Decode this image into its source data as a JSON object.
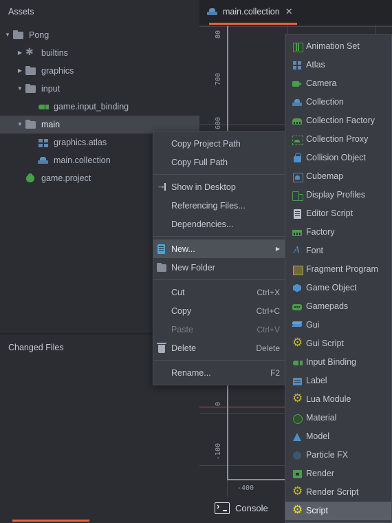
{
  "assets_panel": {
    "title": "Assets",
    "tree": [
      {
        "label": "Pong",
        "icon": "folder-icon",
        "arrow": "open",
        "indent": 0,
        "selected": false
      },
      {
        "label": "builtins",
        "icon": "builtins-icon",
        "arrow": "closed",
        "indent": 1,
        "selected": false
      },
      {
        "label": "graphics",
        "icon": "folder-icon",
        "arrow": "closed",
        "indent": 1,
        "selected": false
      },
      {
        "label": "input",
        "icon": "folder-icon",
        "arrow": "open",
        "indent": 1,
        "selected": false
      },
      {
        "label": "game.input_binding",
        "icon": "input-binding-icon",
        "arrow": "none",
        "indent": 2,
        "selected": false
      },
      {
        "label": "main",
        "icon": "folder-icon",
        "arrow": "open",
        "indent": 1,
        "selected": true
      },
      {
        "label": "graphics.atlas",
        "icon": "atlas-icon",
        "arrow": "none",
        "indent": 2,
        "selected": false
      },
      {
        "label": "main.collection",
        "icon": "collection-icon",
        "arrow": "none",
        "indent": 2,
        "selected": false
      },
      {
        "label": "game.project",
        "icon": "project-icon",
        "arrow": "none",
        "indent": 1,
        "selected": false
      }
    ]
  },
  "changed_files_panel": {
    "title": "Changed Files"
  },
  "editor": {
    "tab_label": "main.collection",
    "tab_icon": "collection-icon",
    "tab_close_glyph": "✕",
    "accent_color": "#e8623a",
    "ruler_y_ticks": [
      "80",
      "700",
      "600",
      "0",
      "-100"
    ],
    "ruler_x_ticks": [
      "-400"
    ]
  },
  "console_bar": {
    "label": "Console",
    "icon": "terminal-icon"
  },
  "context_menu": {
    "items": [
      {
        "label": "Copy Project Path",
        "icon": "",
        "shortcut": "",
        "type": "item",
        "highlight": false,
        "disabled": false,
        "submenu": false
      },
      {
        "label": "Copy Full Path",
        "icon": "",
        "shortcut": "",
        "type": "item",
        "highlight": false,
        "disabled": false,
        "submenu": false
      },
      {
        "label": "",
        "icon": "",
        "shortcut": "",
        "type": "separator",
        "highlight": false,
        "disabled": false,
        "submenu": false
      },
      {
        "label": "Show in Desktop",
        "icon": "show-desktop-icon",
        "shortcut": "",
        "type": "item",
        "highlight": false,
        "disabled": false,
        "submenu": false
      },
      {
        "label": "Referencing Files...",
        "icon": "",
        "shortcut": "",
        "type": "item",
        "highlight": false,
        "disabled": false,
        "submenu": false
      },
      {
        "label": "Dependencies...",
        "icon": "",
        "shortcut": "",
        "type": "item",
        "highlight": false,
        "disabled": false,
        "submenu": false
      },
      {
        "label": "",
        "icon": "",
        "shortcut": "",
        "type": "separator",
        "highlight": false,
        "disabled": false,
        "submenu": false
      },
      {
        "label": "New...",
        "icon": "new-document-icon",
        "shortcut": "",
        "type": "item",
        "highlight": true,
        "disabled": false,
        "submenu": true
      },
      {
        "label": "New Folder",
        "icon": "new-folder-icon",
        "shortcut": "",
        "type": "item",
        "highlight": false,
        "disabled": false,
        "submenu": false
      },
      {
        "label": "",
        "icon": "",
        "shortcut": "",
        "type": "separator",
        "highlight": false,
        "disabled": false,
        "submenu": false
      },
      {
        "label": "Cut",
        "icon": "",
        "shortcut": "Ctrl+X",
        "type": "item",
        "highlight": false,
        "disabled": false,
        "submenu": false
      },
      {
        "label": "Copy",
        "icon": "",
        "shortcut": "Ctrl+C",
        "type": "item",
        "highlight": false,
        "disabled": false,
        "submenu": false
      },
      {
        "label": "Paste",
        "icon": "",
        "shortcut": "Ctrl+V",
        "type": "item",
        "highlight": false,
        "disabled": true,
        "submenu": false
      },
      {
        "label": "Delete",
        "icon": "trash-icon",
        "shortcut": "Delete",
        "type": "item",
        "highlight": false,
        "disabled": false,
        "submenu": false
      },
      {
        "label": "",
        "icon": "",
        "shortcut": "",
        "type": "separator",
        "highlight": false,
        "disabled": false,
        "submenu": false
      },
      {
        "label": "Rename...",
        "icon": "",
        "shortcut": "F2",
        "type": "item",
        "highlight": false,
        "disabled": false,
        "submenu": false
      }
    ]
  },
  "new_submenu": {
    "items": [
      {
        "label": "Animation Set",
        "icon": "animation-set-icon",
        "highlight": false
      },
      {
        "label": "Atlas",
        "icon": "atlas-icon",
        "highlight": false
      },
      {
        "label": "Camera",
        "icon": "camera-icon",
        "highlight": false
      },
      {
        "label": "Collection",
        "icon": "collection-icon",
        "highlight": false
      },
      {
        "label": "Collection Factory",
        "icon": "collection-factory-icon",
        "highlight": false
      },
      {
        "label": "Collection Proxy",
        "icon": "collection-proxy-icon",
        "highlight": false
      },
      {
        "label": "Collision Object",
        "icon": "collision-object-icon",
        "highlight": false
      },
      {
        "label": "Cubemap",
        "icon": "cubemap-icon",
        "highlight": false
      },
      {
        "label": "Display Profiles",
        "icon": "display-profiles-icon",
        "highlight": false
      },
      {
        "label": "Editor Script",
        "icon": "editor-script-icon",
        "highlight": false
      },
      {
        "label": "Factory",
        "icon": "factory-icon",
        "highlight": false
      },
      {
        "label": "Font",
        "icon": "font-icon",
        "highlight": false
      },
      {
        "label": "Fragment Program",
        "icon": "fragment-program-icon",
        "highlight": false
      },
      {
        "label": "Game Object",
        "icon": "game-object-icon",
        "highlight": false
      },
      {
        "label": "Gamepads",
        "icon": "gamepads-icon",
        "highlight": false
      },
      {
        "label": "Gui",
        "icon": "gui-icon",
        "highlight": false
      },
      {
        "label": "Gui Script",
        "icon": "gui-script-icon",
        "highlight": false
      },
      {
        "label": "Input Binding",
        "icon": "input-binding-icon",
        "highlight": false
      },
      {
        "label": "Label",
        "icon": "label-icon",
        "highlight": false
      },
      {
        "label": "Lua Module",
        "icon": "lua-module-icon",
        "highlight": false
      },
      {
        "label": "Material",
        "icon": "material-icon",
        "highlight": false
      },
      {
        "label": "Model",
        "icon": "model-icon",
        "highlight": false
      },
      {
        "label": "Particle FX",
        "icon": "particle-fx-icon",
        "highlight": false
      },
      {
        "label": "Render",
        "icon": "render-icon",
        "highlight": false
      },
      {
        "label": "Render Script",
        "icon": "render-script-icon",
        "highlight": false
      },
      {
        "label": "Script",
        "icon": "script-icon",
        "highlight": true
      }
    ]
  }
}
